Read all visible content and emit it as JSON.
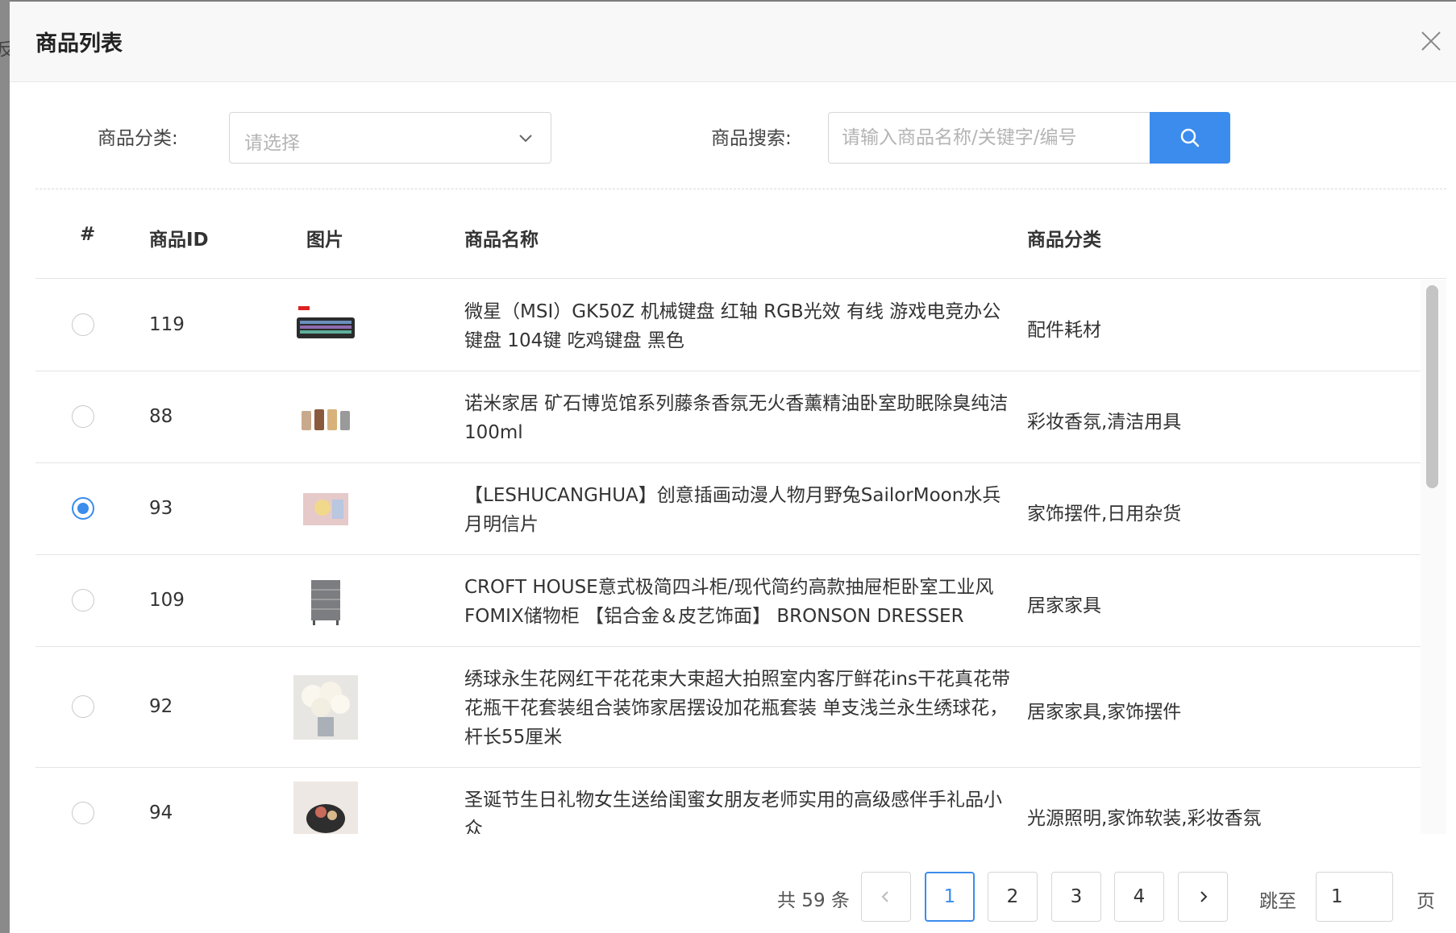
{
  "backdrop": {
    "partial_char": "反"
  },
  "modal": {
    "title": "商品列表"
  },
  "filters": {
    "category_label": "商品分类:",
    "category_placeholder": "请选择",
    "search_label": "商品搜索:",
    "search_placeholder": "请输入商品名称/关键字/编号"
  },
  "table": {
    "headers": {
      "select": "#",
      "id": "商品ID",
      "image": "图片",
      "name": "商品名称",
      "category": "商品分类"
    },
    "rows": [
      {
        "id": "119",
        "name": "微星（MSI）GK50Z 机械键盘 红轴 RGB光效 有线 游戏电竞办公键盘 104键 吃鸡键盘 黑色",
        "category": "配件耗材",
        "selected": false,
        "image": "keyboard-thumbnail"
      },
      {
        "id": "88",
        "name": "诺米家居 矿石博览馆系列藤条香氛无火香薰精油卧室助眠除臭纯洁100ml",
        "category": "彩妆香氛,清洁用具",
        "selected": false,
        "image": "perfume-bottles-thumbnail"
      },
      {
        "id": "93",
        "name": "【LESHUCANGHUA】创意插画动漫人物月野兔SailorMoon水兵月明信片",
        "category": "家饰摆件,日用杂货",
        "selected": true,
        "image": "postcard-thumbnail"
      },
      {
        "id": "109",
        "name": "CROFT HOUSE意式极简四斗柜/现代简约高款抽屉柜卧室工业风FOMIX储物柜 【铝合金＆皮艺饰面】 BRONSON DRESSER",
        "category": "居家家具",
        "selected": false,
        "image": "dresser-thumbnail"
      },
      {
        "id": "92",
        "name": "绣球永生花网红干花花束大束超大拍照室内客厅鲜花ins干花真花带花瓶干花套装组合装饰家居摆设加花瓶套装 单支浅兰永生绣球花，杆长55厘米",
        "category": "居家家具,家饰摆件",
        "selected": false,
        "image": "flowers-thumbnail"
      },
      {
        "id": "94",
        "name": "圣诞节生日礼物女生送给闺蜜女朋友老师实用的高级感伴手礼品小众",
        "category": "光源照明,家饰软装,彩妆香氛",
        "selected": false,
        "image": "gift-thumbnail"
      }
    ]
  },
  "pagination": {
    "total_text": "共 59 条",
    "pages": [
      "1",
      "2",
      "3",
      "4"
    ],
    "current_page": "1",
    "goto_label": "跳至",
    "goto_value": "1",
    "page_suffix": "页"
  },
  "colors": {
    "primary": "#3b8ced",
    "border": "#d6d6d6",
    "header_bg": "#f8f8f8"
  }
}
